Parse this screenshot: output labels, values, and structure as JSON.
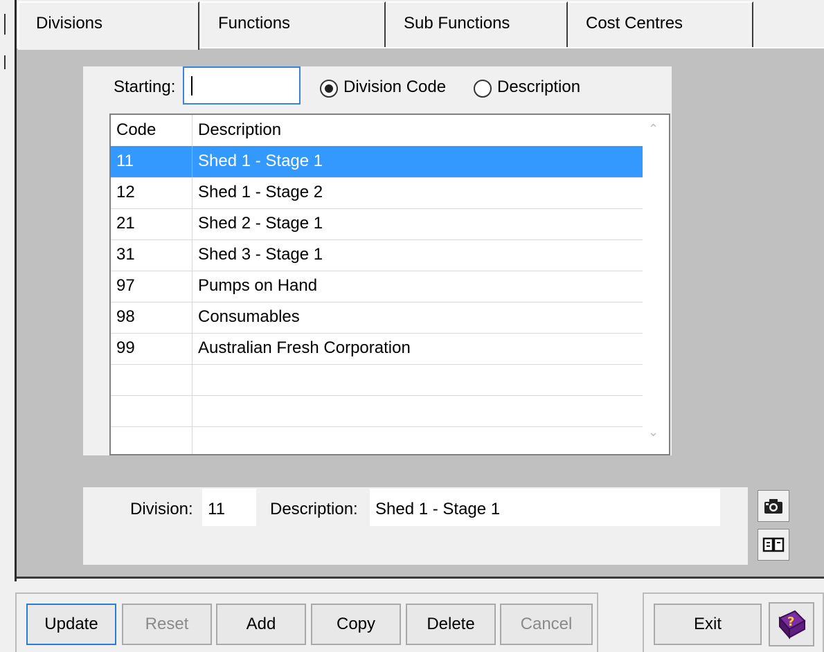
{
  "tabs": [
    {
      "label": "Divisions",
      "active": true
    },
    {
      "label": "Functions",
      "active": false
    },
    {
      "label": "Sub Functions",
      "active": false
    },
    {
      "label": "Cost Centres",
      "active": false
    }
  ],
  "search": {
    "label": "Starting:",
    "value": "",
    "radio_options": [
      {
        "label": "Division Code",
        "checked": true
      },
      {
        "label": "Description",
        "checked": false
      }
    ]
  },
  "table": {
    "columns": [
      "Code",
      "Description"
    ],
    "rows": [
      {
        "code": "11",
        "description": "Shed 1 - Stage 1",
        "selected": true
      },
      {
        "code": "12",
        "description": "Shed 1 - Stage 2"
      },
      {
        "code": "21",
        "description": "Shed 2 - Stage 1"
      },
      {
        "code": "31",
        "description": "Shed 3 - Stage 1"
      },
      {
        "code": "97",
        "description": "Pumps on Hand"
      },
      {
        "code": "98",
        "description": "Consumables"
      },
      {
        "code": "99",
        "description": "Australian Fresh Corporation"
      }
    ],
    "empty_rows": 3
  },
  "detail": {
    "division_label": "Division:",
    "division_value": "11",
    "description_label": "Description:",
    "description_value": "Shed 1 - Stage 1"
  },
  "side_icons": [
    "camera-icon",
    "book-icon"
  ],
  "buttons": {
    "update": "Update",
    "reset": "Reset",
    "add": "Add",
    "copy": "Copy",
    "delete": "Delete",
    "cancel": "Cancel",
    "exit": "Exit",
    "help_icon": "help-book-icon"
  },
  "colors": {
    "selection": "#3399ff",
    "panel": "#c0c0c0",
    "focus_border": "#3b84d4"
  }
}
